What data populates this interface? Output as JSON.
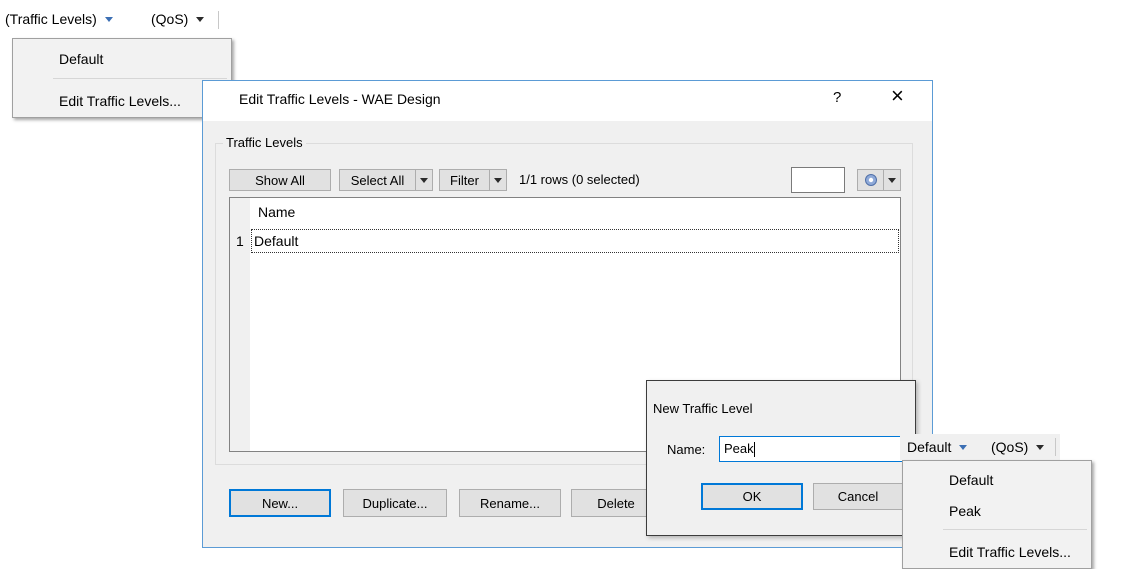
{
  "toolbar": {
    "traffic_levels_label": "(Traffic Levels)",
    "qos_label": "(QoS)"
  },
  "traffic_menu": {
    "items": [
      "Default",
      "Edit Traffic Levels..."
    ]
  },
  "edit_dialog": {
    "title": "Edit Traffic Levels - WAE Design",
    "help": "?",
    "close": "×",
    "group_label": "Traffic Levels",
    "show_all": "Show All",
    "select_all": "Select All",
    "filter": "Filter",
    "rows_status": "1/1 rows (0 selected)",
    "search_value": "",
    "table": {
      "columns": [
        "Name"
      ],
      "rows": [
        {
          "num": "1",
          "name": "Default"
        }
      ]
    },
    "buttons": {
      "new": "New...",
      "duplicate": "Duplicate...",
      "rename": "Rename...",
      "delete": "Delete"
    }
  },
  "new_dialog": {
    "title": "New Traffic Level",
    "name_label": "Name:",
    "name_value": "Peak",
    "ok": "OK",
    "cancel": "Cancel"
  },
  "toolbar2": {
    "traffic_levels_label": "Default",
    "qos_label": "(QoS)"
  },
  "traffic_menu2": {
    "items": [
      "Default",
      "Peak",
      "Edit Traffic Levels..."
    ]
  },
  "icons": [
    "dropdown-arrow-icon",
    "close-icon",
    "help-icon",
    "settings-icon"
  ],
  "colors": {
    "accent": "#0078d7",
    "dialog_border": "#5b9bd5",
    "menu_bg": "#f2f2f2",
    "button_bg": "#e1e1e1"
  }
}
